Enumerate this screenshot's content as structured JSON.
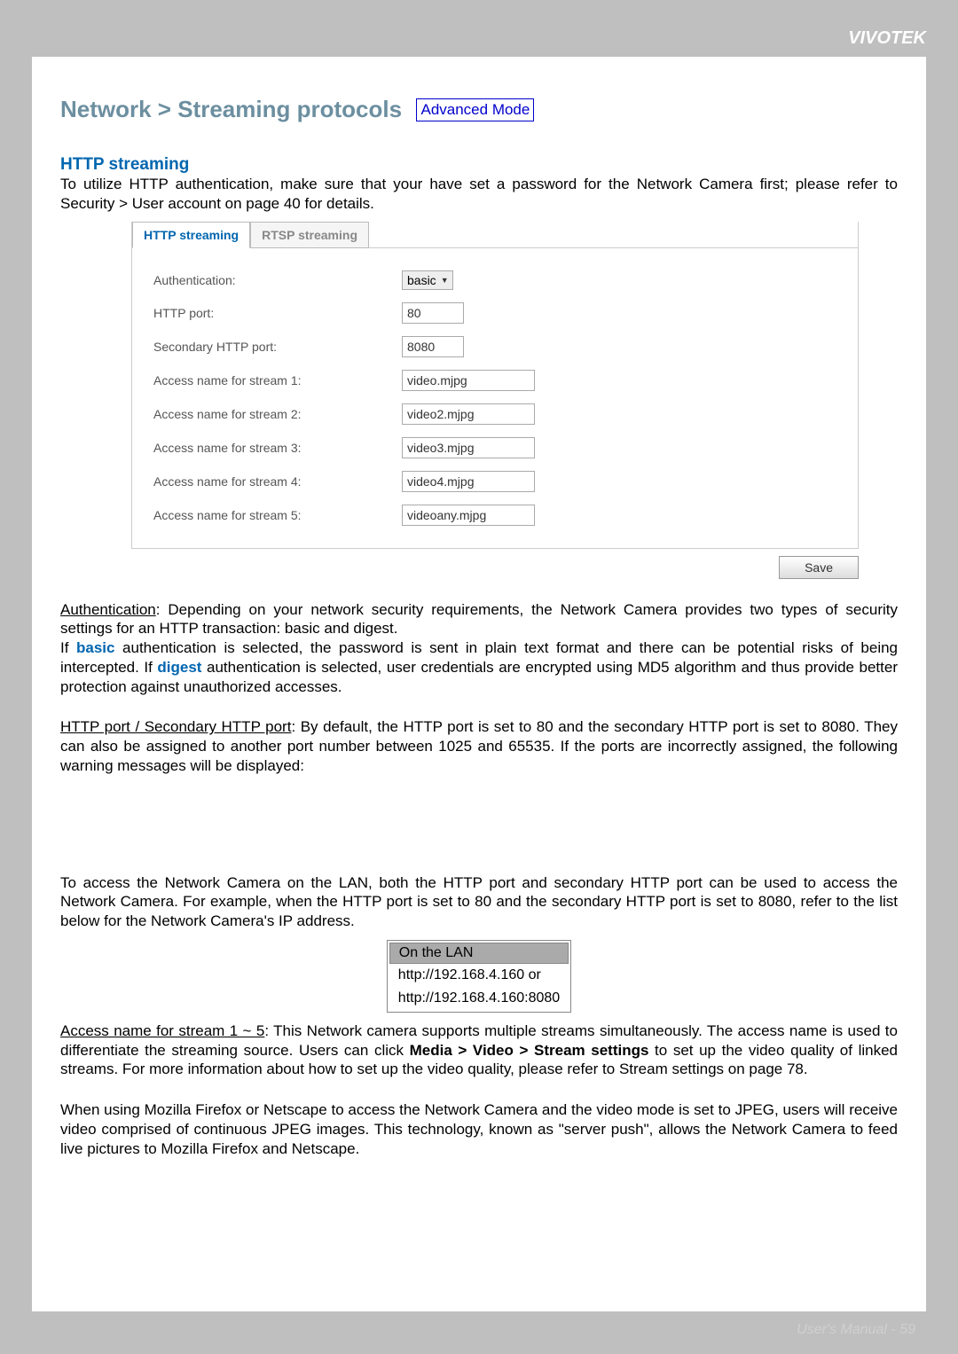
{
  "brand": "VIVOTEK",
  "page_title": "Network > Streaming protocols",
  "badge": "Advanced Mode",
  "http_streaming_heading": "HTTP streaming",
  "intro_text": "To utilize HTTP authentication, make sure that your have set a password for the Network Camera first; please refer to Security > User account on page 40 for details.",
  "tabs": {
    "http": "HTTP streaming",
    "rtsp": "RTSP streaming"
  },
  "form": {
    "auth_label": "Authentication:",
    "auth_value": "basic",
    "http_port_label": "HTTP port:",
    "http_port_value": "80",
    "sec_http_port_label": "Secondary HTTP port:",
    "sec_http_port_value": "8080",
    "stream1_label": "Access name for stream 1:",
    "stream1_value": "video.mjpg",
    "stream2_label": "Access name for stream 2:",
    "stream2_value": "video2.mjpg",
    "stream3_label": "Access name for stream 3:",
    "stream3_value": "video3.mjpg",
    "stream4_label": "Access name for stream 4:",
    "stream4_value": "video4.mjpg",
    "stream5_label": "Access name for stream 5:",
    "stream5_value": "videoany.mjpg"
  },
  "save_button": "Save",
  "para_auth_lead": "Authentication",
  "para_auth_rest": ": Depending on your network security requirements, the Network Camera provides two types of security settings for an HTTP transaction: basic and digest.",
  "para_auth2_pre": "If ",
  "para_auth2_basic": "basic",
  "para_auth2_mid": " authentication is selected, the password is sent in plain text format and there can be potential risks of being intercepted. If ",
  "para_auth2_digest": "digest",
  "para_auth2_end": " authentication is selected, user credentials are encrypted using MD5 algorithm and thus provide better protection against unauthorized accesses.",
  "para_port_lead": "HTTP port / Secondary HTTP port",
  "para_port_rest": ": By default, the HTTP port is set to 80 and the secondary HTTP port is set to 8080. They can also be assigned to another port number between 1025 and 65535. If the ports are incorrectly assigned, the following warning messages will be displayed:",
  "para_lan": "To access the Network Camera on the LAN, both the HTTP port and secondary HTTP port can be used to access the Network Camera. For example, when the HTTP port is set to 80 and the secondary HTTP port is set to 8080, refer to the list below for the Network Camera's IP address.",
  "lan_table": {
    "header": "On the LAN",
    "row1": "http://192.168.4.160  or",
    "row2": "http://192.168.4.160:8080"
  },
  "para_access_lead": "Access name for stream 1 ~ 5",
  "para_access_rest_pre": ": This Network camera supports multiple streams simultaneously. The access name is used to differentiate the streaming source. Users can click ",
  "para_access_bold": "Media > Video > Stream settings",
  "para_access_rest_post": " to set up the video quality of linked streams. For more information about how to set up the video quality, please refer to Stream settings on page 78.",
  "para_firefox": "When using Mozilla Firefox or Netscape to access the Network Camera and the video mode is set to JPEG, users will receive video comprised of continuous JPEG images. This technology, known as \"server push\", allows the Network Camera to feed live pictures to Mozilla Firefox and Netscape.",
  "footer": "User's Manual - 59"
}
